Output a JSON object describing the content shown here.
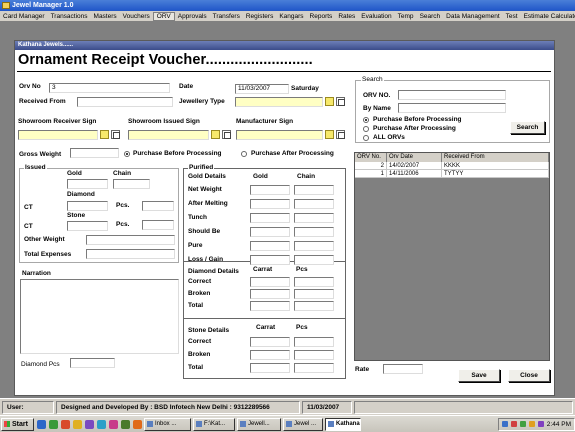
{
  "app": {
    "title": "Jewel Manager 1.0"
  },
  "menu": [
    "Card Manager",
    "Transactions",
    "Masters",
    "Vouchers",
    "ORV",
    "Approvals",
    "Transfers",
    "Registers",
    "Kangars",
    "Reports",
    "Rates",
    "Evaluation",
    "Temp",
    "Search",
    "Data Management",
    "Test",
    "Estimate Calculator"
  ],
  "menu_active": "ORV",
  "form": {
    "window_title": "Kathana Jewels......",
    "heading": "Ornament Receipt Voucher..........................",
    "orv_no_label": "Orv No",
    "orv_no": "3",
    "date_label": "Date",
    "date": "11/03/2007",
    "day": "Saturday",
    "received_from_label": "Received From",
    "received_from": "",
    "jewellery_type_label": "Jewellery Type",
    "jewellery_type": "",
    "showroom_receiver_label": "Showroom Receiver Sign",
    "showroom_issued_label": "Showroom Issued Sign",
    "manufacturer_label": "Manufacturer Sign",
    "gross_weight_label": "Gross Weight",
    "gross_weight": "",
    "processing_before": "Purchase Before Processing",
    "processing_after": "Purchase After Processing",
    "processing_selected": "before"
  },
  "issued": {
    "title": "Issued",
    "gold": "Gold",
    "chain": "Chain",
    "ct": "CT",
    "diamond": "Diamond",
    "pcs": "Pcs.",
    "stone": "Stone",
    "ct2": "CT",
    "pcs2": "Pcs.",
    "other_weight": "Other Weight",
    "total_expenses": "Total Expenses"
  },
  "purified": {
    "title": "Purified",
    "gold_details": "Gold Details",
    "gold": "Gold",
    "chain": "Chain",
    "rows": [
      "Net Weight",
      "After Melting",
      "Tunch",
      "Should Be",
      "Pure",
      "Loss / Gain"
    ],
    "diamond_details": "Diamond Details",
    "carrat": "Carrat",
    "pcs": "Pcs",
    "diamond_rows": [
      "Correct",
      "Broken",
      "Total"
    ],
    "stone_details": "Stone Details",
    "stone_carrat": "Carrat",
    "stone_pcs": "Pcs",
    "stone_rows": [
      "Correct",
      "Broken",
      "Total"
    ]
  },
  "narration": {
    "label": "Narration",
    "diamond_pcs_label": "Diamond Pcs"
  },
  "search": {
    "title": "Search",
    "orv_no_label": "ORV NO.",
    "by_name_label": "By Name",
    "opt_before": "Purchase Before Processing",
    "opt_after": "Purchase After Processing",
    "opt_all": "ALL ORVs",
    "selected": "before",
    "button": "Search"
  },
  "grid": {
    "headers": [
      "ORV No.",
      "Orv Date",
      "Received From"
    ],
    "rows": [
      [
        "2",
        "14/02/2007",
        "KKKK"
      ],
      [
        "1",
        "14/11/2006",
        "TYTYY"
      ]
    ]
  },
  "rate_label": "Rate",
  "save_button": "Save",
  "close_button": "Close",
  "status": {
    "user": "User:",
    "developer": "Designed and Developed By : BSD Infotech New Delhi : 9312289566",
    "date": "11/03/2007"
  },
  "taskbar": {
    "start": "Start",
    "tasks": [
      "Inbox ...",
      "F:\\Kat...",
      "Jewell...",
      "Jewel ...",
      "Kathana ..."
    ],
    "active_task": "Kathana ...",
    "clock": "2:44 PM"
  },
  "colors": {
    "titlebar": "#1f55c8",
    "mdi_background": "#808080",
    "grid_background": "#808080",
    "required_field": "#ffffc4"
  }
}
